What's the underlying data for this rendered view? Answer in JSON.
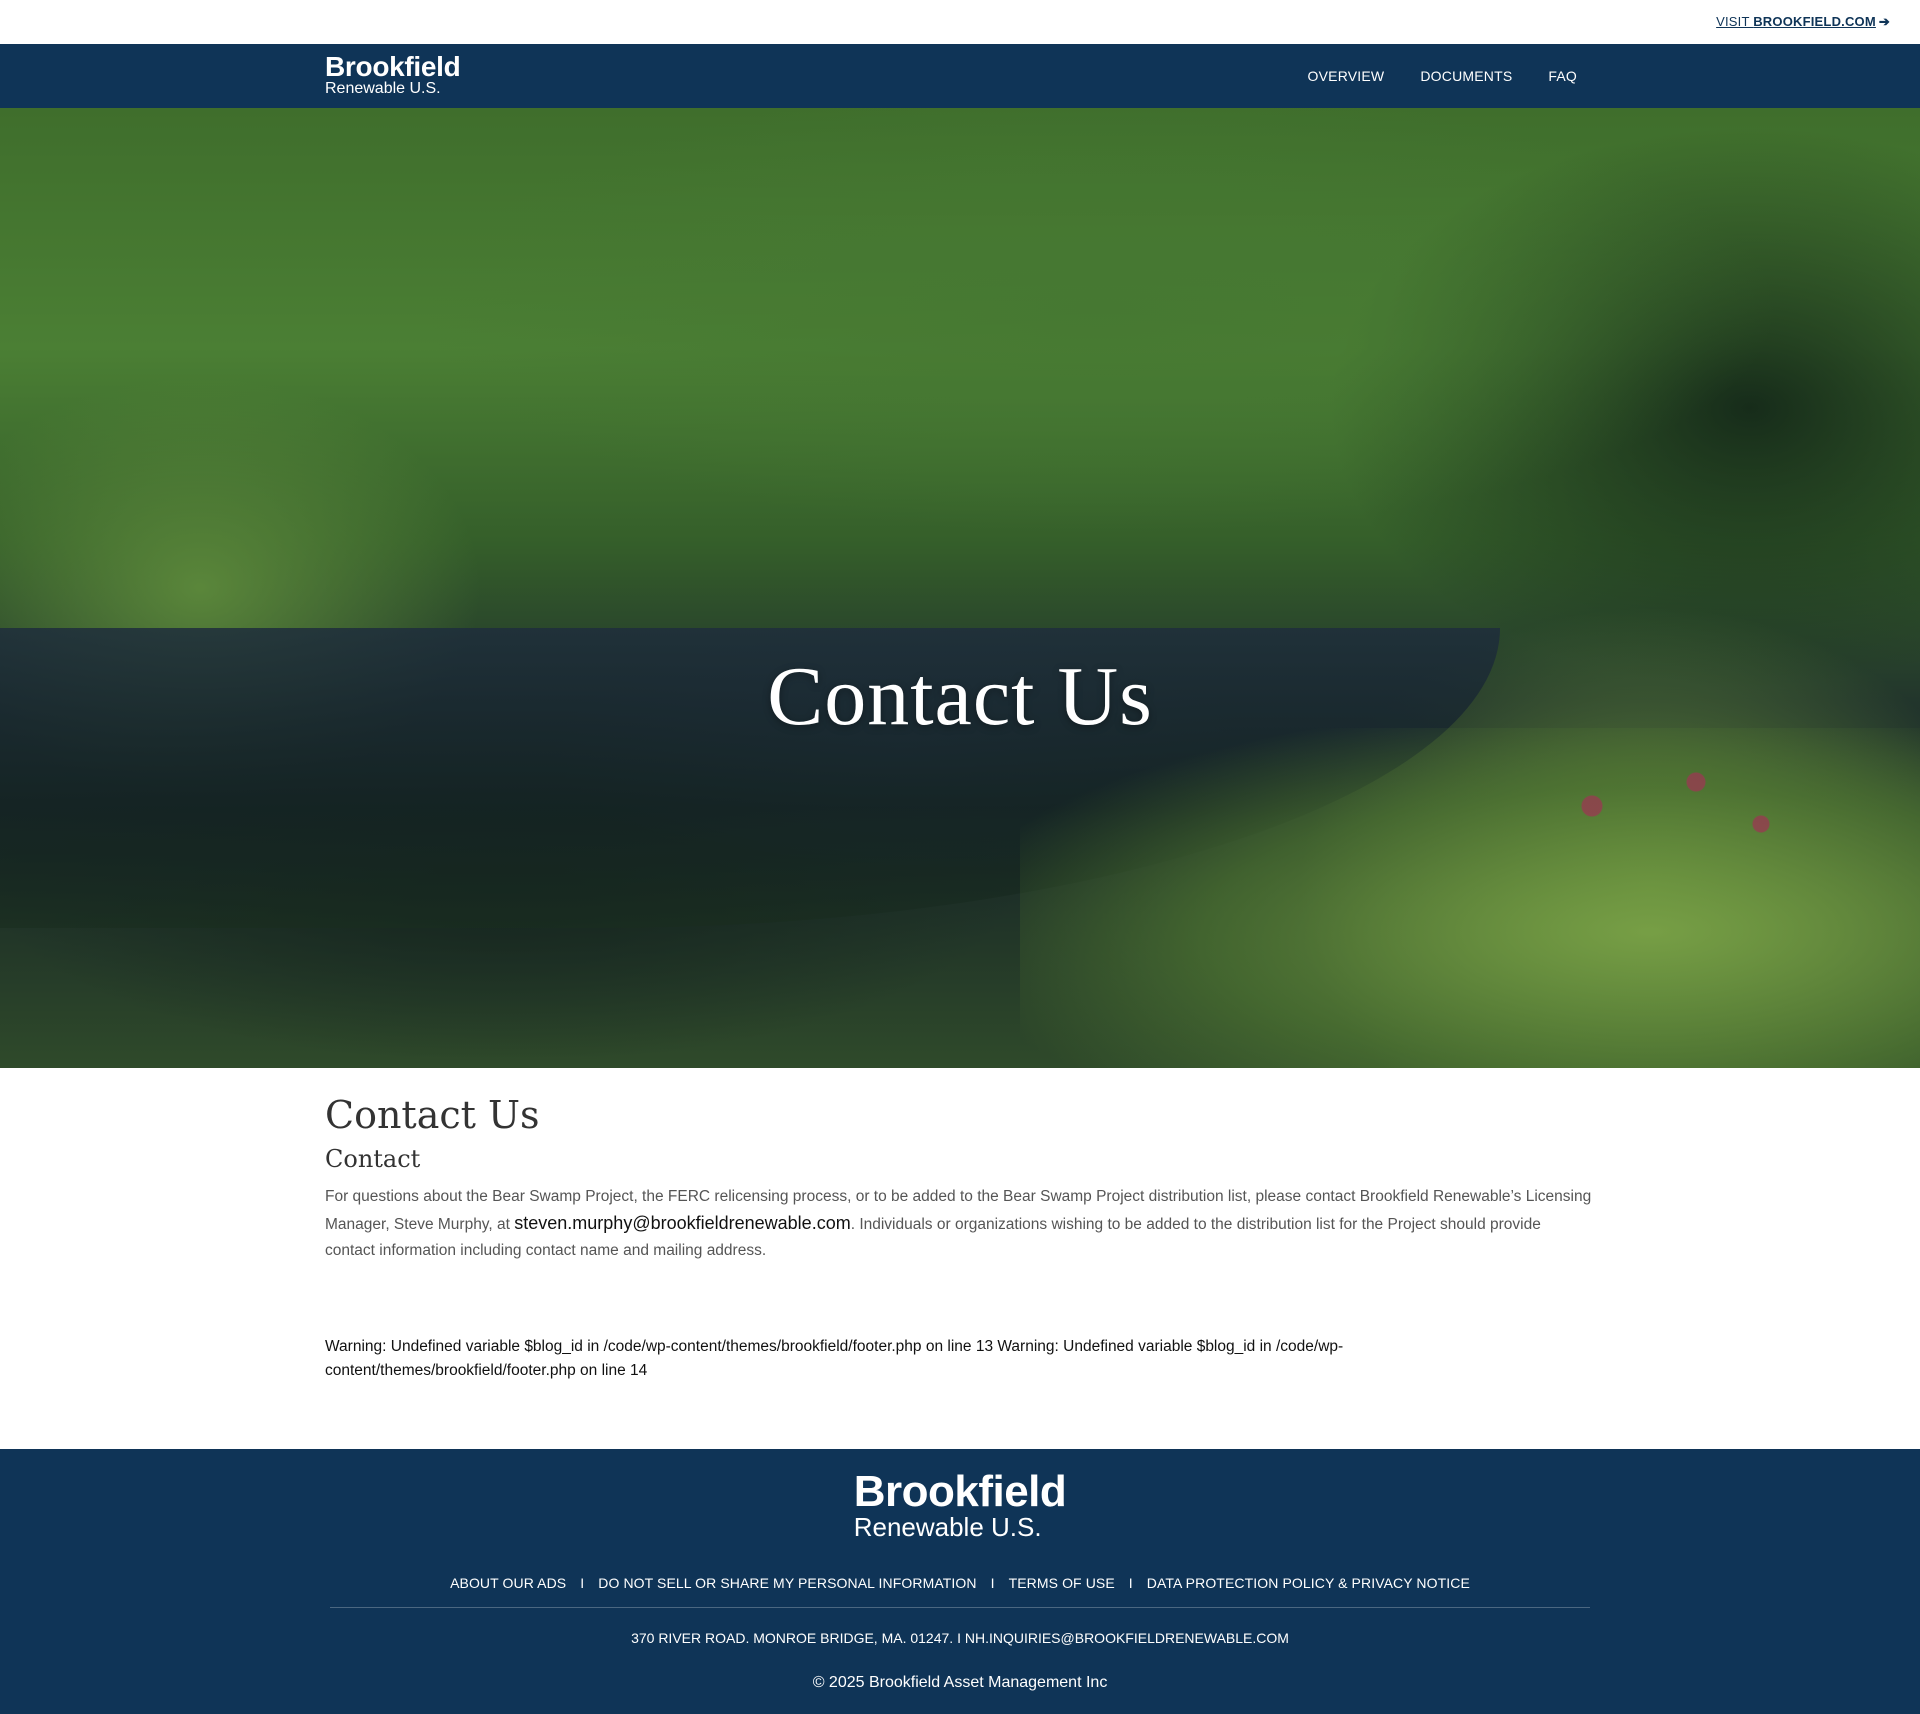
{
  "topbar": {
    "visit_prefix": "VISIT ",
    "visit_link": "BROOKFIELD.COM",
    "arrow": "➔"
  },
  "logo": {
    "line1": "Brookfield",
    "line2": "Renewable U.S."
  },
  "nav": {
    "items": [
      "OVERVIEW",
      "DOCUMENTS",
      "FAQ"
    ]
  },
  "hero": {
    "title": "Contact Us"
  },
  "content": {
    "heading": "Contact Us",
    "subheading": "Contact",
    "para_before": "For questions about the Bear Swamp Project, the FERC relicensing process, or to be added to the Bear Swamp Project distribution list, please contact Brookfield Renewable’s Licensing Manager, Steve Murphy, at ",
    "email": "steven.murphy@brookfieldrenewable.com",
    "para_after": ". Individuals or organizations wishing to be added to the distribution list for the Project should provide contact information including contact name and mailing address."
  },
  "warning": "Warning: Undefined variable $blog_id in /code/wp-content/themes/brookfield/footer.php on line 13 Warning: Undefined variable $blog_id in /code/wp-content/themes/brookfield/footer.php on line 14",
  "footer": {
    "logo_line1": "Brookfield",
    "logo_line2": "Renewable U.S.",
    "links": [
      "ABOUT OUR ADS",
      "DO NOT SELL OR SHARE MY PERSONAL INFORMATION",
      "TERMS OF USE",
      "DATA PROTECTION POLICY & PRIVACY NOTICE"
    ],
    "separator": "I",
    "address": "370 RIVER ROAD. MONROE BRIDGE, MA. 01247. I NH.INQUIRIES@BROOKFIELDRENEWABLE.COM",
    "copyright": "© 2025 Brookfield Asset Management Inc"
  },
  "colors": {
    "brand_navy": "#0f3457"
  }
}
